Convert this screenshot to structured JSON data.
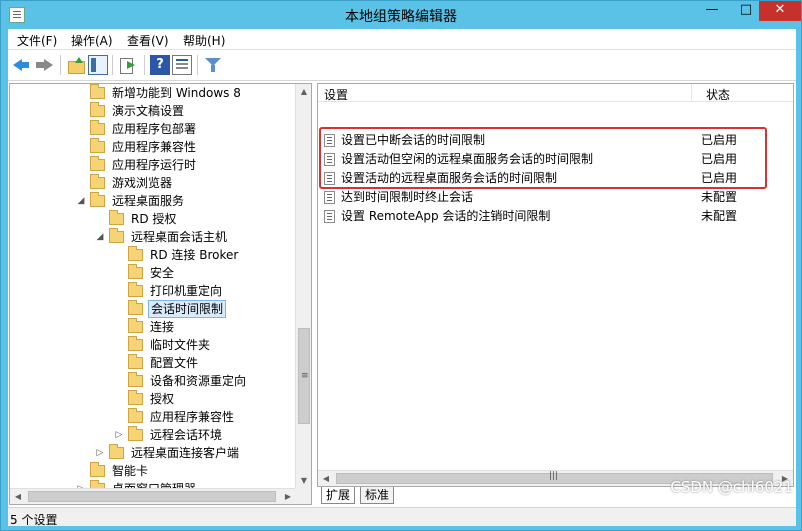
{
  "window": {
    "title": "本地组策略编辑器",
    "minimize": "—",
    "maximize": "□",
    "close": "✕"
  },
  "menu": [
    "文件(F)",
    "操作(A)",
    "查看(V)",
    "帮助(H)"
  ],
  "toolbar": {
    "help": "?"
  },
  "tree": {
    "items": [
      {
        "label": "新增功能到 Windows 8",
        "indent": 0,
        "expander": ""
      },
      {
        "label": "演示文稿设置",
        "indent": 0,
        "expander": ""
      },
      {
        "label": "应用程序包部署",
        "indent": 0,
        "expander": ""
      },
      {
        "label": "应用程序兼容性",
        "indent": 0,
        "expander": ""
      },
      {
        "label": "应用程序运行时",
        "indent": 0,
        "expander": ""
      },
      {
        "label": "游戏浏览器",
        "indent": 0,
        "expander": ""
      },
      {
        "label": "远程桌面服务",
        "indent": 0,
        "expander": "◢"
      },
      {
        "label": "RD 授权",
        "indent": 1,
        "expander": ""
      },
      {
        "label": "远程桌面会话主机",
        "indent": 1,
        "expander": "◢"
      },
      {
        "label": "RD 连接 Broker",
        "indent": 2,
        "expander": ""
      },
      {
        "label": "安全",
        "indent": 2,
        "expander": ""
      },
      {
        "label": "打印机重定向",
        "indent": 2,
        "expander": ""
      },
      {
        "label": "会话时间限制",
        "indent": 2,
        "expander": "",
        "selected": true
      },
      {
        "label": "连接",
        "indent": 2,
        "expander": ""
      },
      {
        "label": "临时文件夹",
        "indent": 2,
        "expander": ""
      },
      {
        "label": "配置文件",
        "indent": 2,
        "expander": ""
      },
      {
        "label": "设备和资源重定向",
        "indent": 2,
        "expander": ""
      },
      {
        "label": "授权",
        "indent": 2,
        "expander": ""
      },
      {
        "label": "应用程序兼容性",
        "indent": 2,
        "expander": ""
      },
      {
        "label": "远程会话环境",
        "indent": 2,
        "expander": "▷"
      },
      {
        "label": "远程桌面连接客户端",
        "indent": 1,
        "expander": "▷"
      },
      {
        "label": "智能卡",
        "indent": 0,
        "expander": ""
      },
      {
        "label": "桌面窗口管理器",
        "indent": 0,
        "expander": "▷"
      }
    ]
  },
  "list": {
    "columns": {
      "setting": "设置",
      "state": "状态"
    },
    "rows": [
      {
        "name": "设置已中断会话的时间限制",
        "state": "已启用"
      },
      {
        "name": "设置活动但空闲的远程桌面服务会话的时间限制",
        "state": "已启用"
      },
      {
        "name": "设置活动的远程桌面服务会话的时间限制",
        "state": "已启用"
      },
      {
        "name": "达到时间限制时终止会话",
        "state": "未配置"
      },
      {
        "name": "设置 RemoteApp 会话的注销时间限制",
        "state": "未配置"
      }
    ]
  },
  "tabs": {
    "extended": "扩展",
    "standard": "标准"
  },
  "status": {
    "text": "5 个设置"
  },
  "watermark": "CSDN @chl6021"
}
